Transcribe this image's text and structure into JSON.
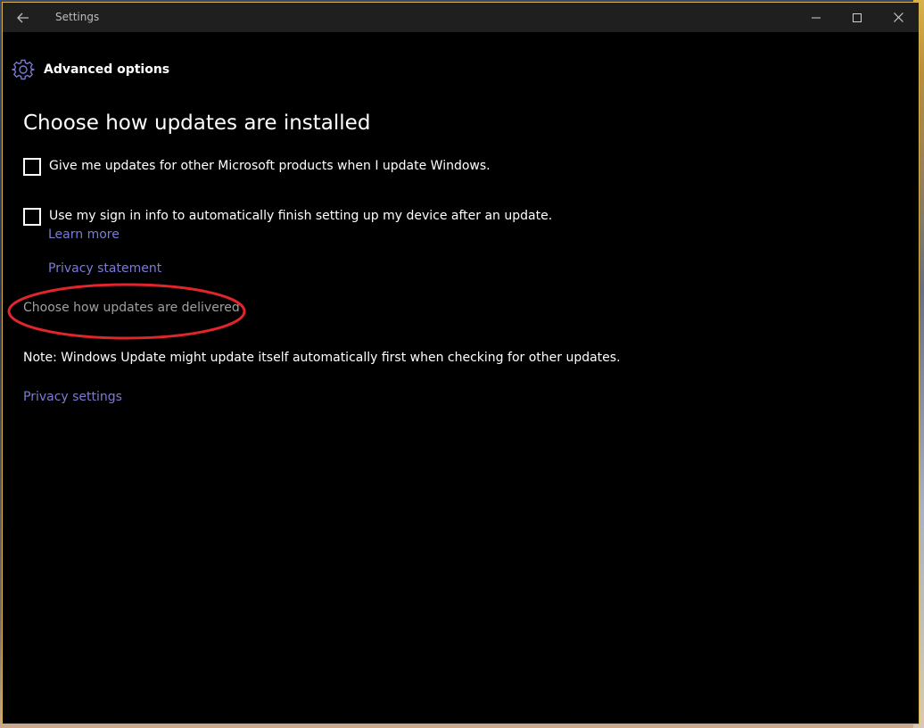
{
  "window": {
    "title": "Settings",
    "icons": {
      "back": "back-arrow-icon",
      "minimize": "minimize-icon",
      "maximize": "maximize-icon",
      "close": "close-icon"
    }
  },
  "header": {
    "icon": "gear-icon",
    "title": "Advanced options"
  },
  "main": {
    "section_title": "Choose how updates are installed",
    "options": [
      {
        "label": "Give me updates for other Microsoft products when I update Windows.",
        "checked": false
      },
      {
        "label": "Use my sign in info to automatically finish setting up my device after an update.",
        "checked": false
      }
    ],
    "learn_more": "Learn more",
    "privacy_statement": "Privacy statement",
    "delivered_link": "Choose how updates are delivered",
    "note": "Note: Windows Update might update itself automatically first when checking for other updates.",
    "privacy_settings": "Privacy settings"
  },
  "colors": {
    "accent": "#7b7bd6",
    "background": "#000000",
    "titlebar": "#1f1f1f",
    "highlight_annotation": "#e0262b",
    "window_border": "#d8b24a"
  }
}
